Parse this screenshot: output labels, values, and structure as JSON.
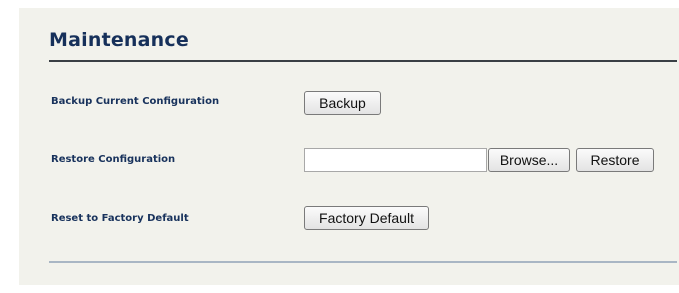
{
  "maintenance": {
    "title": "Maintenance",
    "backup": {
      "label": "Backup Current Configuration",
      "button": "Backup"
    },
    "restore": {
      "label": "Restore Configuration",
      "file_value": "",
      "browse_button": "Browse...",
      "restore_button": "Restore"
    },
    "reset": {
      "label": "Reset to Factory Default",
      "button": "Factory Default"
    }
  }
}
